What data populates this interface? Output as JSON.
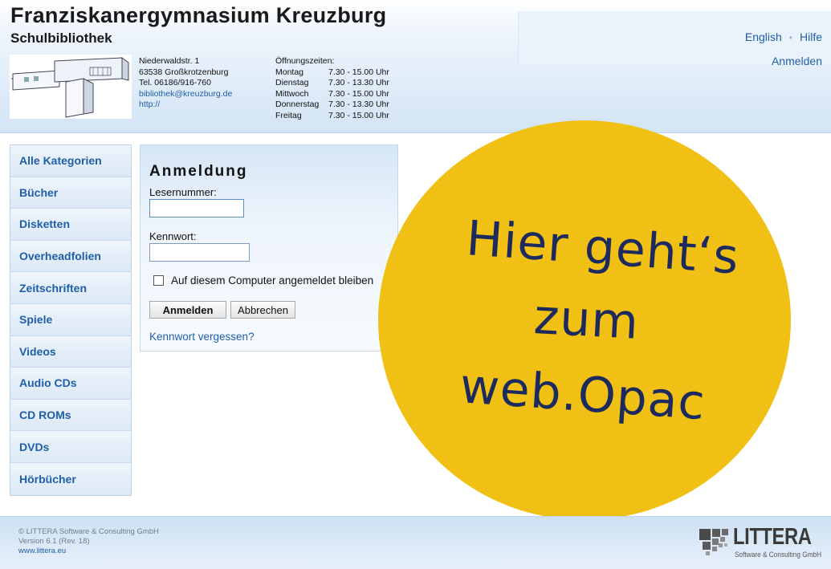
{
  "header": {
    "title": "Franziskanergymnasium Kreuzburg",
    "subtitle": "Schulbibliothek",
    "address": {
      "street": "Niederwaldstr. 1",
      "city": "63538 Großkrotzenburg",
      "phone": "Tel. 06186/916-760",
      "email": "bibliothek@kreuzburg.de",
      "web": "http://"
    },
    "hours": {
      "heading": "Öffnungszeiten:",
      "rows": [
        {
          "day": "Montag",
          "time": "7.30 - 15.00 Uhr"
        },
        {
          "day": "Dienstag",
          "time": "7.30 - 13.30 Uhr"
        },
        {
          "day": "Mittwoch",
          "time": "7.30 - 15.00 Uhr"
        },
        {
          "day": "Donnerstag",
          "time": "7.30 - 13.30 Uhr"
        },
        {
          "day": "Freitag",
          "time": "7.30 - 15.00 Uhr"
        }
      ]
    },
    "links": {
      "english": "English",
      "separator": "•",
      "help": "Hilfe",
      "login": "Anmelden"
    }
  },
  "sidebar": {
    "items": [
      {
        "label": "Alle Kategorien"
      },
      {
        "label": "Bücher"
      },
      {
        "label": "Disketten"
      },
      {
        "label": "Overheadfolien"
      },
      {
        "label": "Zeitschriften"
      },
      {
        "label": "Spiele"
      },
      {
        "label": "Videos"
      },
      {
        "label": "Audio CDs"
      },
      {
        "label": "CD ROMs"
      },
      {
        "label": "DVDs"
      },
      {
        "label": "Hörbücher"
      }
    ]
  },
  "login": {
    "title": "Anmeldung",
    "reader_label": "Lesernummer:",
    "reader_value": "",
    "password_label": "Kennwort:",
    "password_value": "",
    "remember_label": "Auf diesem Computer angemeldet bleiben",
    "remember_checked": false,
    "submit_label": "Anmelden",
    "cancel_label": "Abbrechen",
    "forgot_label": "Kennwort vergessen?"
  },
  "promo": {
    "line1": "Hier geht‘s",
    "line2": "zum",
    "line3": "web.Opac",
    "color": "#f0c015",
    "text_color": "#1d2a5e"
  },
  "footer": {
    "copyright": "© LITTERA Software & Consulting GmbH",
    "version": "Version 6.1 (Rev. 18)",
    "link": "www.littera.eu",
    "logo_name": "LITTERA",
    "logo_sub": "Software & Consulting GmbH"
  },
  "colors": {
    "link": "#1f5ea8",
    "header_bg": "#d3e4f5"
  }
}
